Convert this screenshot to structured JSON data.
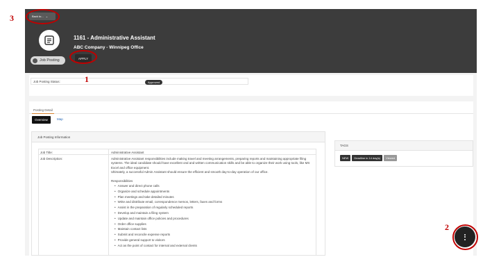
{
  "header": {
    "back_label": "Back to...",
    "job_title": "1161 - Administrative Assistant",
    "company": "ABC Company - Winnipeg Office",
    "pill_label": "Job Posting",
    "apply_label": "APPLY"
  },
  "status": {
    "label": "Job Posting Status:",
    "value": "Approved"
  },
  "tabs": {
    "main": "Posting Detail",
    "overview": "Overview",
    "map": "Map"
  },
  "info": {
    "heading": "Job Posting Information",
    "title_label": "Job Title:",
    "title_value": "Administrative Assistant",
    "desc_label": "Job Description:",
    "desc_para1": "Administrative Assistant responsibilities include making travel and meeting arrangements, preparing reports and maintaining appropriate filing systems. The ideal candidate should have excellent oral and written communication skills and be able to organize their work using tools, like MS Excel and office equipment.",
    "desc_para2": "Ultimately, a successful Admin Assistant should ensure the efficient and smooth day-to-day operation of our office.",
    "resp_heading": "Responsibilities",
    "responsibilities": [
      "Answer and direct phone calls",
      "Organize and schedule appointments",
      "Plan meetings and take detailed minutes",
      "Write and distribute email, correspondence memos, letters, faxes and forms",
      "Assist in the preparation of regularly scheduled reports",
      "Develop and maintain a filing system",
      "Update and maintain office policies and procedures",
      "Order office supplies",
      "Maintain contact lists",
      "Submit and reconcile expense reports",
      "Provide general support to visitors",
      "Act as the point of contact for internal and external clients"
    ]
  },
  "tags": {
    "heading": "TAGS",
    "items": [
      "NEW",
      "Deadline in 14 day(s)",
      "Viewed"
    ]
  },
  "annotations": {
    "marker1": "1",
    "marker2": "2",
    "marker3": "3"
  },
  "colors": {
    "header_bg": "#3c3c3c",
    "highlight": "#c00000",
    "tab_accent": "#d9822b",
    "link": "#2566b5"
  },
  "icons": [
    "chevron-down-icon",
    "document-icon",
    "more-vertical-icon"
  ]
}
